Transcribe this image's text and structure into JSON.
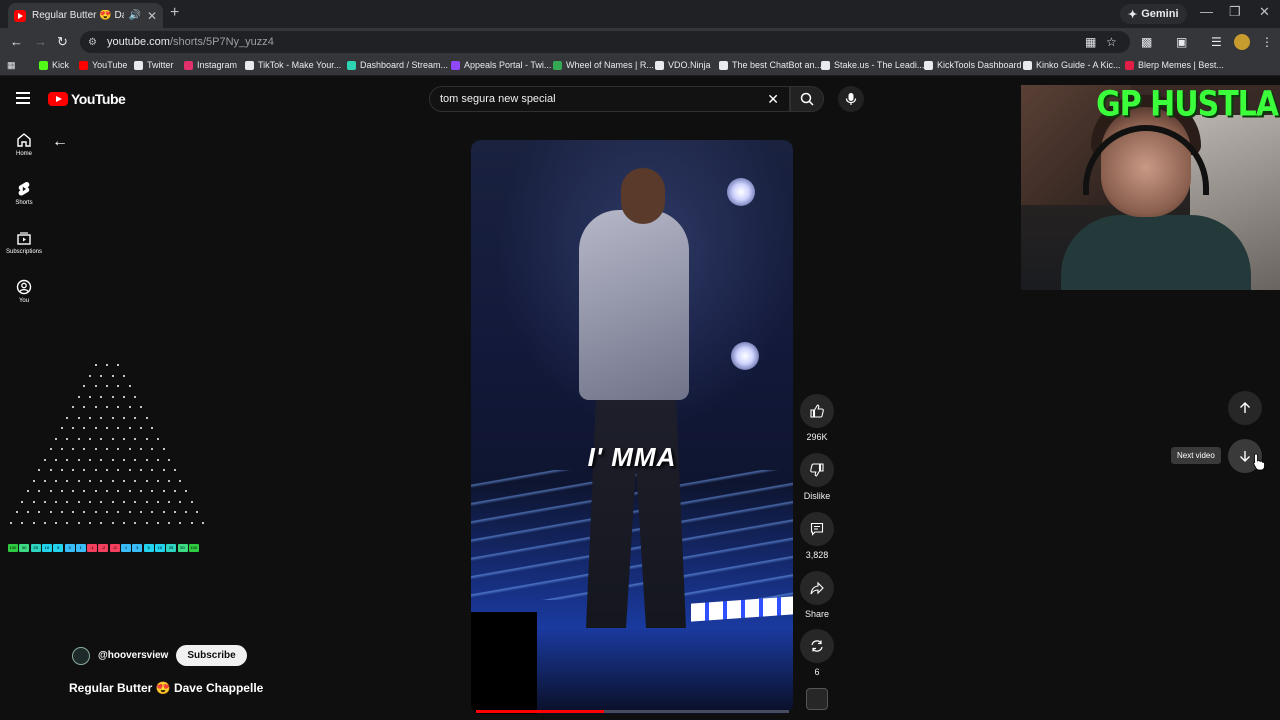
{
  "browser": {
    "tab_title": "Regular Butter 😍 Dave Ch",
    "new_tab": "+",
    "gemini_label": "Gemini",
    "url_domain": "youtube.com",
    "url_path": "/shorts/5P7Ny_yuzz4",
    "bookmarks": [
      {
        "label": "Kick",
        "color": "#53fc18"
      },
      {
        "label": "YouTube",
        "color": "#ff0000"
      },
      {
        "label": "Twitter",
        "color": "#e8eaed"
      },
      {
        "label": "Instagram",
        "color": "#e1306c"
      },
      {
        "label": "TikTok - Make Your...",
        "color": "#e8eaed"
      },
      {
        "label": "Dashboard / Stream...",
        "color": "#2fd5b2"
      },
      {
        "label": "Appeals Portal - Twi...",
        "color": "#9146ff"
      },
      {
        "label": "Wheel of Names | R...",
        "color": "#34a853"
      },
      {
        "label": "VDO.Ninja",
        "color": "#e8eaed"
      },
      {
        "label": "The best ChatBot an...",
        "color": "#e8eaed"
      },
      {
        "label": "Stake.us - The Leadi...",
        "color": "#e8eaed"
      },
      {
        "label": "KickTools Dashboard",
        "color": "#e8eaed"
      },
      {
        "label": "Kinko Guide - A Kic...",
        "color": "#e8eaed"
      },
      {
        "label": "Blerp Memes | Best...",
        "color": "#e11d48"
      }
    ]
  },
  "youtube": {
    "logo_text": "YouTube",
    "search_query": "tom segura new special",
    "rail": [
      {
        "label": "Home",
        "icon": "home-icon"
      },
      {
        "label": "Shorts",
        "icon": "shorts-icon"
      },
      {
        "label": "Subscriptions",
        "icon": "subscriptions-icon"
      },
      {
        "label": "You",
        "icon": "you-icon"
      }
    ],
    "video": {
      "caption": "I' MMA",
      "progress": 0.41
    },
    "actions": {
      "like_count": "296K",
      "dislike_label": "Dislike",
      "comment_count": "3,828",
      "share_label": "Share",
      "remix_count": "6"
    },
    "channel": {
      "handle": "@hooversview",
      "subscribe_label": "Subscribe"
    },
    "title": "Regular Butter 😍 Dave Chappelle",
    "next_tooltip": "Next video"
  },
  "overlays": {
    "webcam_banner": "GP HUSTLA",
    "plinko_slots": [
      {
        "label": "100",
        "color": "#2ecc40"
      },
      {
        "label": "50",
        "color": "#3ddc84"
      },
      {
        "label": "25",
        "color": "#2dd4bf"
      },
      {
        "label": "10",
        "color": "#22d3ee"
      },
      {
        "label": "5",
        "color": "#22d3ee"
      },
      {
        "label": "3",
        "color": "#38bdf8"
      },
      {
        "label": "1",
        "color": "#38bdf8"
      },
      {
        "label": "-1",
        "color": "#f43f5e"
      },
      {
        "label": "-2",
        "color": "#f43f5e"
      },
      {
        "label": "-3",
        "color": "#f43f5e"
      },
      {
        "label": "1",
        "color": "#38bdf8"
      },
      {
        "label": "3",
        "color": "#38bdf8"
      },
      {
        "label": "5",
        "color": "#22d3ee"
      },
      {
        "label": "10",
        "color": "#22d3ee"
      },
      {
        "label": "25",
        "color": "#2dd4bf"
      },
      {
        "label": "50",
        "color": "#3ddc84"
      },
      {
        "label": "100",
        "color": "#2ecc40"
      }
    ]
  }
}
